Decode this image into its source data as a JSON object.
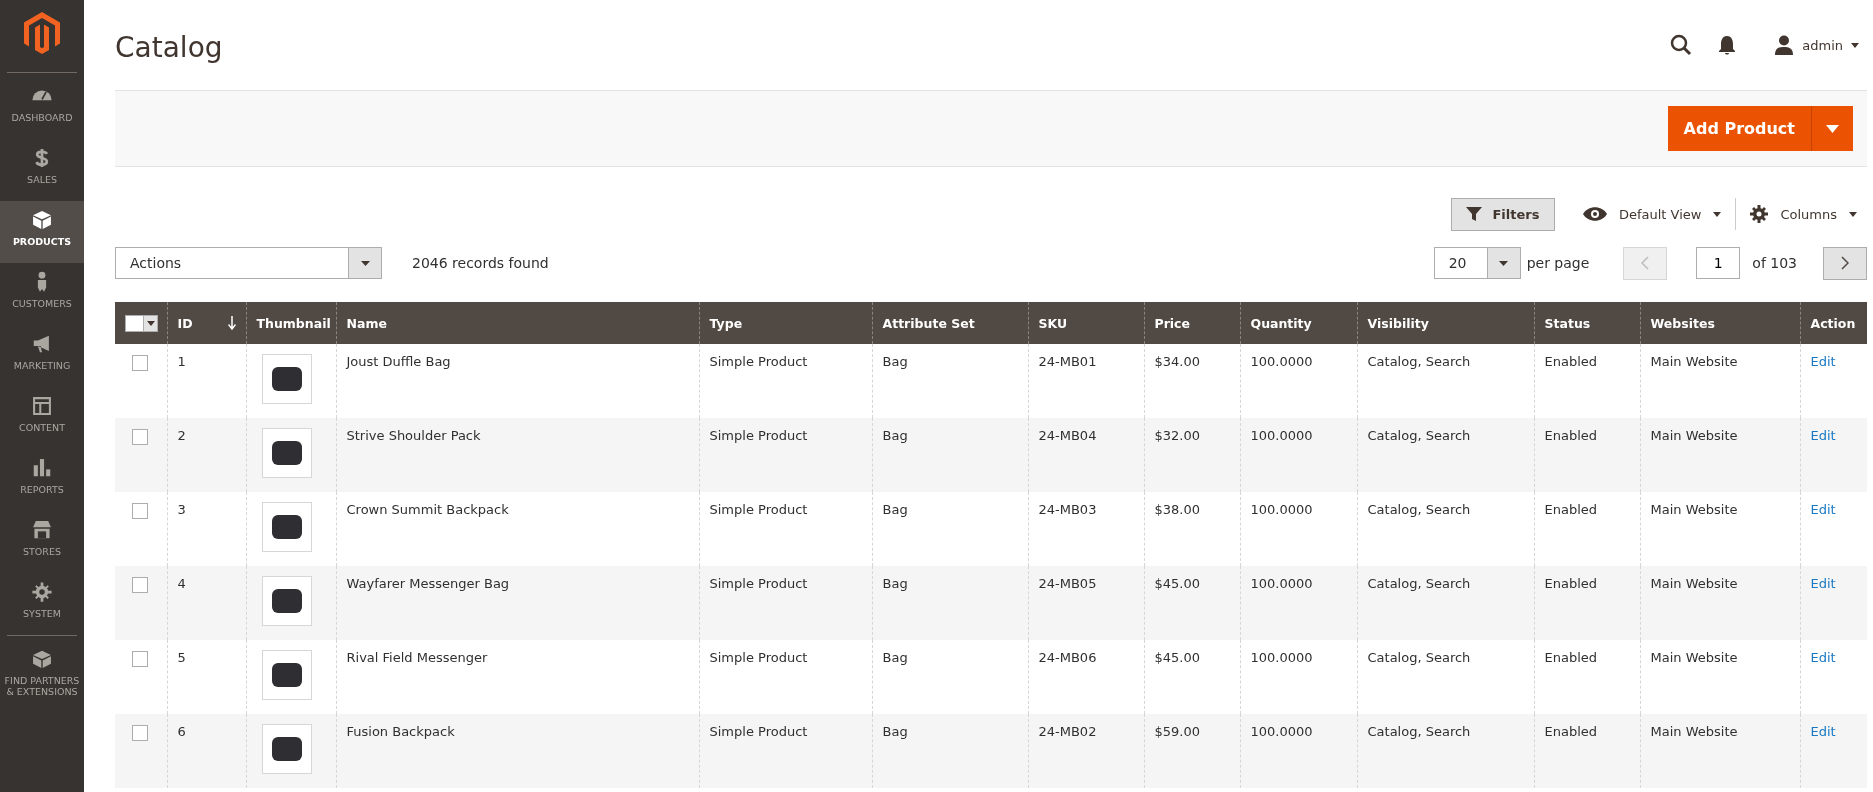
{
  "sidebar": {
    "items": [
      {
        "label": "DASHBOARD",
        "selected": false
      },
      {
        "label": "SALES",
        "selected": false
      },
      {
        "label": "PRODUCTS",
        "selected": true
      },
      {
        "label": "CUSTOMERS",
        "selected": false
      },
      {
        "label": "MARKETING",
        "selected": false
      },
      {
        "label": "CONTENT",
        "selected": false
      },
      {
        "label": "REPORTS",
        "selected": false
      },
      {
        "label": "STORES",
        "selected": false
      },
      {
        "label": "SYSTEM",
        "selected": false
      },
      {
        "label": "FIND PARTNERS & EXTENSIONS",
        "selected": false
      }
    ]
  },
  "header": {
    "title": "Catalog",
    "user": "admin"
  },
  "action_bar": {
    "primary_button": "Add Product"
  },
  "toolbar": {
    "filters": "Filters",
    "view": "Default View",
    "columns": "Columns"
  },
  "grid_controls": {
    "actions": "Actions",
    "records": "2046 records found",
    "page_size": "20",
    "per_page_label": "per page",
    "page": "1",
    "of_pages": "of 103",
    "prev_disabled": true,
    "next_disabled": false
  },
  "table": {
    "all_selected": false,
    "columns": [
      "ID",
      "Thumbnail",
      "Name",
      "Type",
      "Attribute Set",
      "SKU",
      "Price",
      "Quantity",
      "Visibility",
      "Status",
      "Websites",
      "Action"
    ],
    "rows": [
      {
        "selected": false,
        "id": "1",
        "name": "Joust Duffle Bag",
        "type": "Simple Product",
        "attribute_set": "Bag",
        "sku": "24-MB01",
        "price": "$34.00",
        "quantity": "100.0000",
        "visibility": "Catalog, Search",
        "status": "Enabled",
        "websites": "Main Website",
        "action": "Edit"
      },
      {
        "selected": false,
        "id": "2",
        "name": "Strive Shoulder Pack",
        "type": "Simple Product",
        "attribute_set": "Bag",
        "sku": "24-MB04",
        "price": "$32.00",
        "quantity": "100.0000",
        "visibility": "Catalog, Search",
        "status": "Enabled",
        "websites": "Main Website",
        "action": "Edit"
      },
      {
        "selected": false,
        "id": "3",
        "name": "Crown Summit Backpack",
        "type": "Simple Product",
        "attribute_set": "Bag",
        "sku": "24-MB03",
        "price": "$38.00",
        "quantity": "100.0000",
        "visibility": "Catalog, Search",
        "status": "Enabled",
        "websites": "Main Website",
        "action": "Edit"
      },
      {
        "selected": false,
        "id": "4",
        "name": "Wayfarer Messenger Bag",
        "type": "Simple Product",
        "attribute_set": "Bag",
        "sku": "24-MB05",
        "price": "$45.00",
        "quantity": "100.0000",
        "visibility": "Catalog, Search",
        "status": "Enabled",
        "websites": "Main Website",
        "action": "Edit"
      },
      {
        "selected": false,
        "id": "5",
        "name": "Rival Field Messenger",
        "type": "Simple Product",
        "attribute_set": "Bag",
        "sku": "24-MB06",
        "price": "$45.00",
        "quantity": "100.0000",
        "visibility": "Catalog, Search",
        "status": "Enabled",
        "websites": "Main Website",
        "action": "Edit"
      },
      {
        "selected": false,
        "id": "6",
        "name": "Fusion Backpack",
        "type": "Simple Product",
        "attribute_set": "Bag",
        "sku": "24-MB02",
        "price": "$59.00",
        "quantity": "100.0000",
        "visibility": "Catalog, Search",
        "status": "Enabled",
        "websites": "Main Website",
        "action": "Edit"
      }
    ]
  }
}
